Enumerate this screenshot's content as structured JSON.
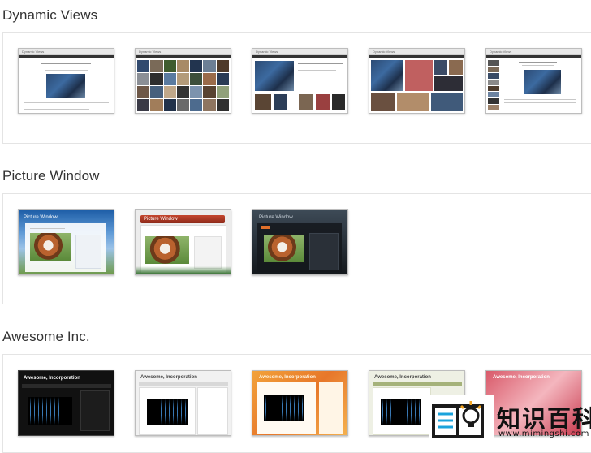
{
  "sections": {
    "dynamic_views": {
      "title": "Dynamic Views",
      "thumb_caption": "Dynamic Views"
    },
    "picture_window": {
      "title": "Picture Window",
      "thumb_caption": "Picture Window"
    },
    "awesome_inc": {
      "title": "Awesome Inc.",
      "thumb_caption": "Awesome, Incorporation"
    }
  },
  "watermark": {
    "text": "知识百科",
    "url": "www.mimingshi.com",
    "icon": "book-lightbulb-icon"
  },
  "colors": {
    "accent_blue": "#1aa3dc",
    "text": "#333333",
    "panel_border": "#e4e4e4"
  }
}
